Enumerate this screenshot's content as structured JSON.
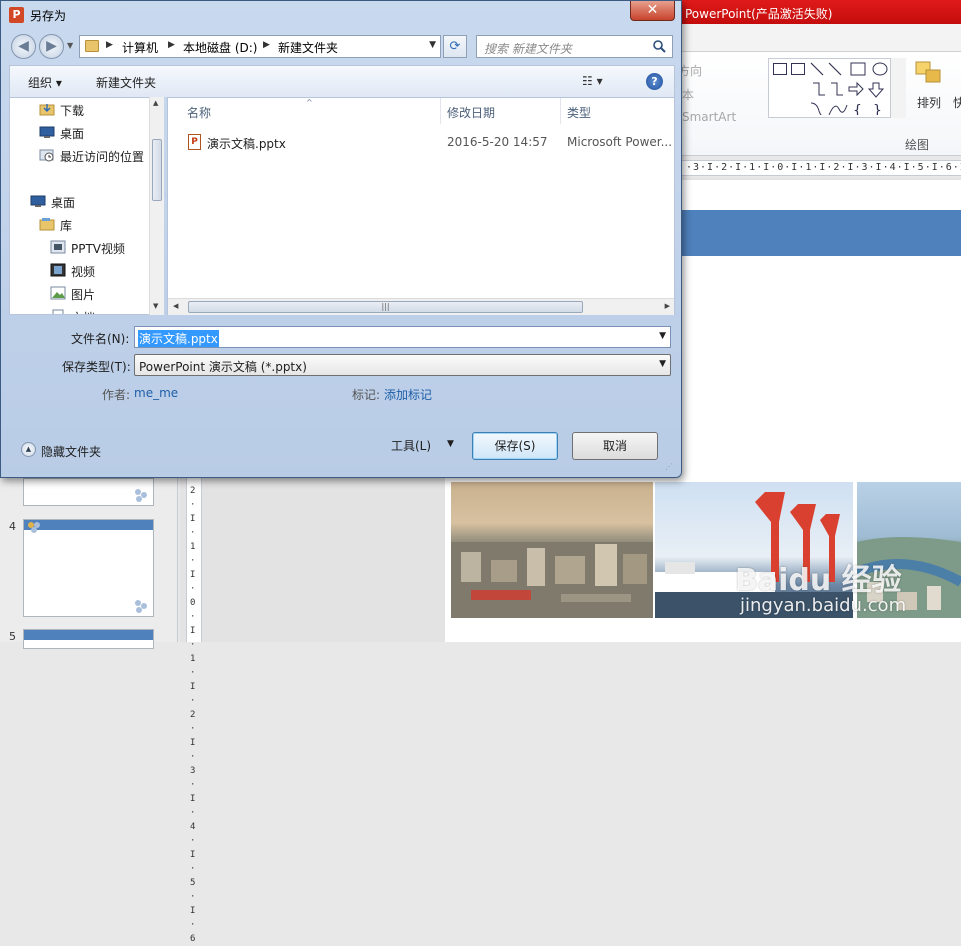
{
  "ppt": {
    "title": "PowerPoint(产品激活失败)",
    "ribbon": {
      "direction_label": "方向",
      "text_label": "本",
      "smartart_label": "SmartArt",
      "arrange_label": "排列",
      "more_label": "快",
      "drawing_group_label": "绘图"
    },
    "ruler": "·3·I·2·I·1·I·0·I·1·I·2·I·3·I·4·I·5·I·6·I·7·I·8·I·9",
    "vruler": "2·I·1·I·0·I·1·I·2·I·3·I·4·I·5·I·6",
    "thumbnails": [
      {
        "number": "4"
      },
      {
        "number": "5"
      }
    ],
    "watermark": "Baidu 经验",
    "watermark_url": "jingyan.baidu.com"
  },
  "dialog": {
    "title": "另存为",
    "app_icon": "P",
    "close_glyph": "✕",
    "address": {
      "segments": [
        "计算机",
        "本地磁盘 (D:)",
        "新建文件夹"
      ]
    },
    "search_placeholder": "搜索 新建文件夹",
    "toolbar": {
      "organize_label": "组织 ▾",
      "new_folder_label": "新建文件夹",
      "view_label": "☷ ▾",
      "help_glyph": "?"
    },
    "nav": {
      "items": [
        {
          "label": "下载",
          "icon": "download-folder-icon"
        },
        {
          "label": "桌面",
          "icon": "desktop-icon"
        },
        {
          "label": "最近访问的位置",
          "icon": "recent-places-icon"
        },
        {
          "label": "桌面",
          "icon": "desktop-icon"
        },
        {
          "label": "库",
          "icon": "library-icon"
        },
        {
          "label": "PPTV视频",
          "icon": "video-library-icon"
        },
        {
          "label": "视频",
          "icon": "video-library-icon"
        },
        {
          "label": "图片",
          "icon": "pictures-library-icon"
        },
        {
          "label": "文档",
          "icon": "documents-library-icon"
        }
      ]
    },
    "columns": {
      "name": "名称",
      "modified": "修改日期",
      "type": "类型"
    },
    "files": [
      {
        "name": "演示文稿.pptx",
        "modified": "2016-5-20 14:57",
        "type": "Microsoft Power..."
      }
    ],
    "form": {
      "filename_label": "文件名(N):",
      "filename_value": "演示文稿.pptx",
      "filetype_label": "保存类型(T):",
      "filetype_value": "PowerPoint 演示文稿 (*.pptx)",
      "author_label": "作者:",
      "author_value": "me_me",
      "tags_label": "标记:",
      "tags_value": "添加标记"
    },
    "footer": {
      "hide_folders_label": "隐藏文件夹",
      "tools_label": "工具(L)",
      "save_label": "保存(S)",
      "cancel_label": "取消"
    }
  }
}
